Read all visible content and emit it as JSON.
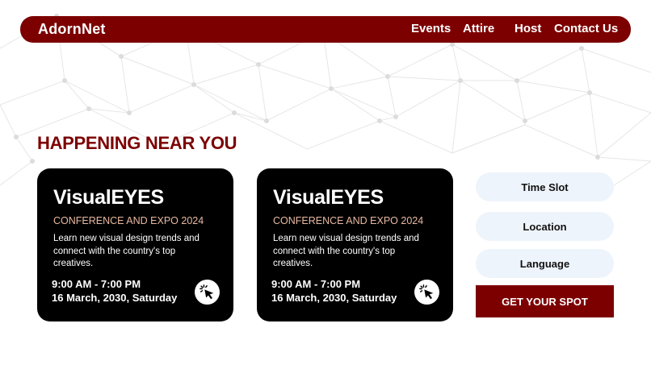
{
  "header": {
    "brand": "AdornNet",
    "nav": [
      "Events",
      "Attire",
      "Host",
      "Contact Us"
    ]
  },
  "section_title": "HAPPENING NEAR YOU",
  "events": [
    {
      "title": "VisualEYES",
      "subtitle": "CONFERENCE AND EXPO 2024",
      "description": "Learn new visual design trends and connect with the country's top creatives.",
      "time": "9:00 AM - 7:00 PM",
      "date": "16 March, 2030, Saturday",
      "icon": "cursor-click-icon"
    },
    {
      "title": "VisualEYES",
      "subtitle": "CONFERENCE AND EXPO 2024",
      "description": "Learn new visual design trends and connect with the country's top creatives.",
      "time": "9:00 AM - 7:00 PM",
      "date": "16 March, 2030, Saturday",
      "icon": "cursor-click-icon"
    }
  ],
  "filters": [
    "Time Slot",
    "Location",
    "Language"
  ],
  "cta_label": "GET YOUR SPOT",
  "colors": {
    "brand": "#7d0000",
    "card_bg": "#000000",
    "subtitle": "#e8b9a0",
    "pill_bg": "#eef4fb",
    "network": "#d9d9d9"
  }
}
